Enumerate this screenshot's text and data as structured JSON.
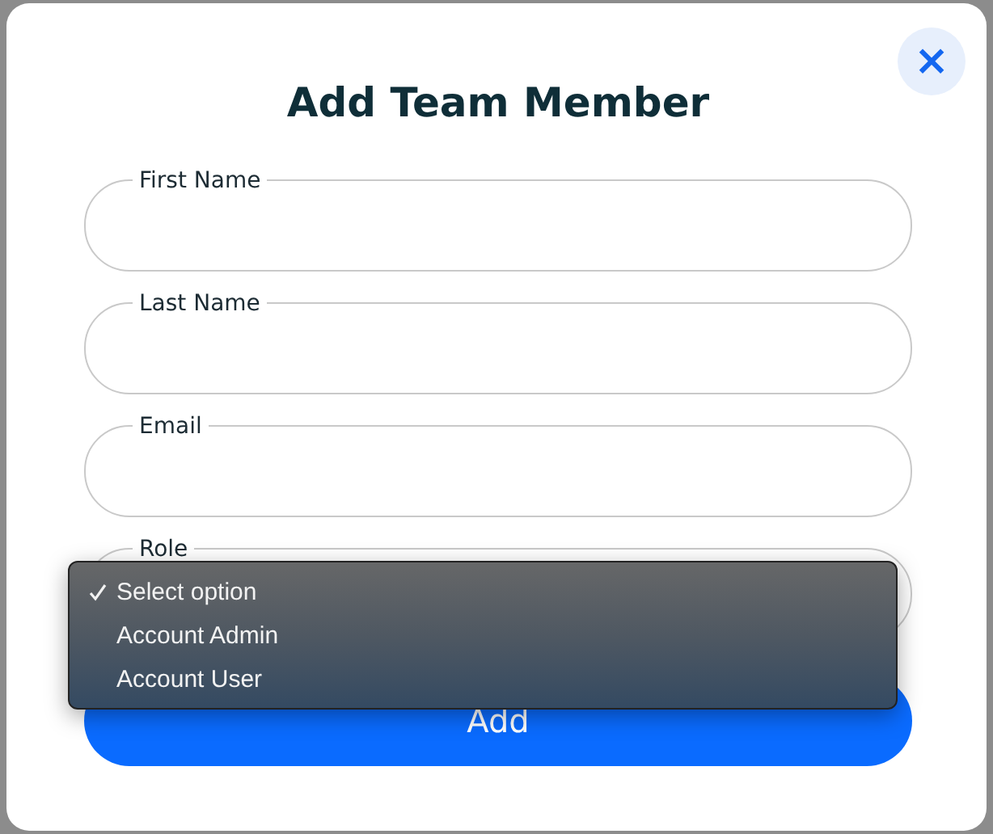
{
  "dialog": {
    "title": "Add Team Member",
    "close_label": "×"
  },
  "fields": [
    {
      "label": "First Name"
    },
    {
      "label": "Last Name"
    },
    {
      "label": "Email"
    },
    {
      "label": "Role"
    }
  ],
  "submit": "Add",
  "role_menu": {
    "open": true,
    "options": [
      {
        "label": "Select option",
        "selected": true
      },
      {
        "label": "Account Admin",
        "selected": false
      },
      {
        "label": "Account User",
        "selected": false
      }
    ]
  }
}
